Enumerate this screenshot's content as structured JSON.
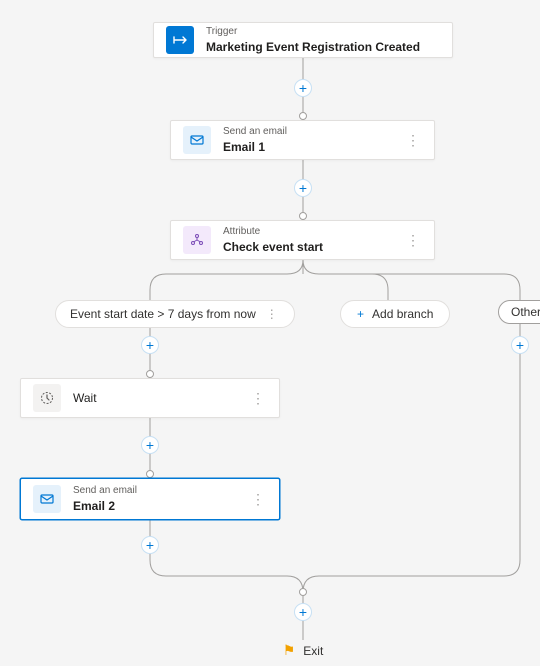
{
  "trigger": {
    "label": "Trigger",
    "title": "Marketing Event Registration Created",
    "icon": "trigger-icon"
  },
  "email1": {
    "label": "Send an email",
    "title": "Email 1",
    "icon": "email-icon"
  },
  "attribute": {
    "label": "Attribute",
    "title": "Check event start",
    "icon": "attribute-icon"
  },
  "condition": {
    "text": "Event start date > 7 days from now"
  },
  "addBranch": {
    "text": "Add branch"
  },
  "other": {
    "text": "Other"
  },
  "wait": {
    "title": "Wait",
    "icon": "wait-icon"
  },
  "email2": {
    "label": "Send an email",
    "title": "Email 2",
    "icon": "email-icon"
  },
  "exit": {
    "text": "Exit"
  }
}
